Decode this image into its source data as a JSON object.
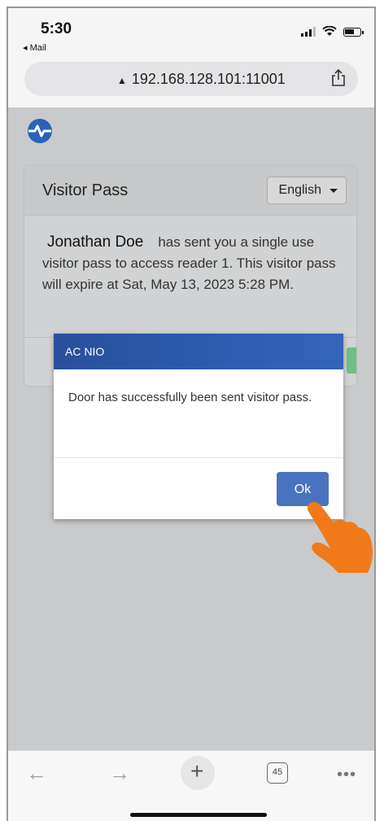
{
  "status_bar": {
    "time": "5:30",
    "back_app": "◂ Mail"
  },
  "address_bar": {
    "url": "192.168.128.101:11001"
  },
  "card": {
    "title": "Visitor Pass",
    "language": "English",
    "sender_name": "Jonathan Doe",
    "message": "has sent you a single use visitor pass to access reader 1. This visitor pass will expire at Sat, May 13, 2023 5:28 PM."
  },
  "modal": {
    "title": "AC NIO",
    "message": "Door has successfully been sent visitor pass.",
    "ok_label": "Ok"
  },
  "toolbar": {
    "back": "←",
    "forward": "→",
    "new_tab": "+",
    "tab_count": "45",
    "more": "•••"
  },
  "colors": {
    "modal_header": "#2c5fb3",
    "ok_button": "#4a73bf",
    "hand": "#f07a1a",
    "logo": "#2a63b8"
  }
}
